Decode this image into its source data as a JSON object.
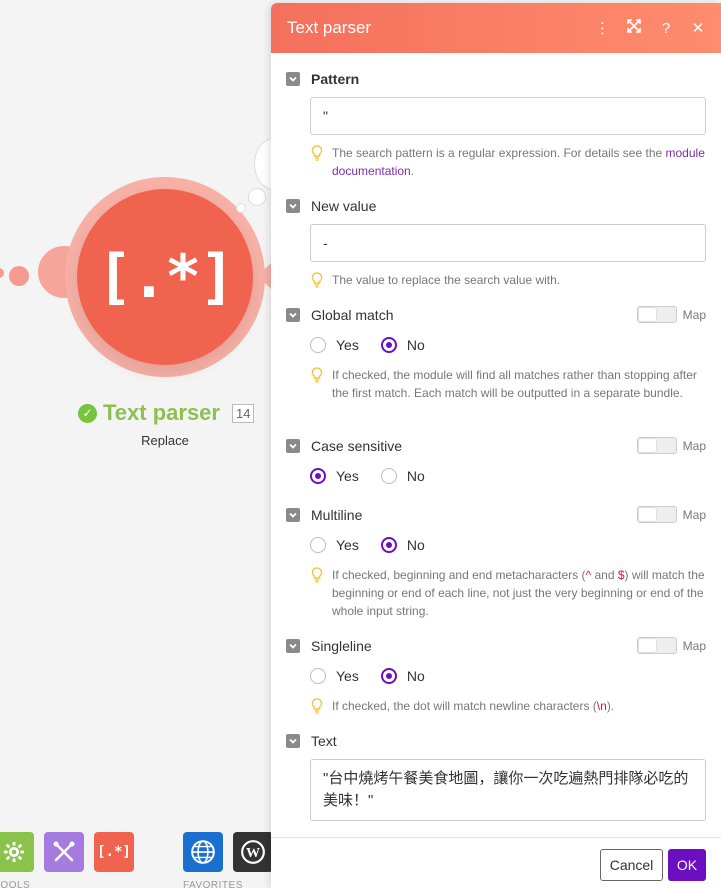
{
  "canvas": {
    "module": {
      "glyph": "[.*]",
      "title": "Text parser",
      "op_count": "14",
      "subtitle": "Replace"
    },
    "toolbar": {
      "label_tools": "TOOLS",
      "label_favorites": "FAVORITES",
      "text_parser_glyph": "[.*]"
    }
  },
  "panel": {
    "title": "Text parser",
    "header_icons": [
      "more-icon",
      "expand-icon",
      "help-icon",
      "close-icon"
    ],
    "fields": {
      "pattern": {
        "label": "Pattern",
        "value": "\"",
        "hint_text": "The search pattern is a regular expression. For details see the ",
        "hint_link": "module documentation",
        "hint_end": "."
      },
      "new_value": {
        "label": "New value",
        "value": "-",
        "hint": "The value to replace the search value with."
      },
      "global_match": {
        "label": "Global match",
        "map_label": "Map",
        "yes": "Yes",
        "no": "No",
        "selected": "No",
        "hint": "If checked, the module will find all matches rather than stopping after the first match. Each match will be outputted in a separate bundle."
      },
      "case_sensitive": {
        "label": "Case sensitive",
        "map_label": "Map",
        "yes": "Yes",
        "no": "No",
        "selected": "Yes"
      },
      "multiline": {
        "label": "Multiline",
        "map_label": "Map",
        "yes": "Yes",
        "no": "No",
        "selected": "No",
        "hint_a": "If checked, beginning and end metacharacters (",
        "hint_caret": "^",
        "hint_b": " and ",
        "hint_dollar": "$",
        "hint_c": ") will match the beginning or end of each line, not just the very beginning or end of the whole input string."
      },
      "singleline": {
        "label": "Singleline",
        "map_label": "Map",
        "yes": "Yes",
        "no": "No",
        "selected": "No",
        "hint_a": "If checked, the dot will match newline characters (",
        "hint_code": "\\n",
        "hint_b": ")."
      },
      "text": {
        "label": "Text",
        "value": "\"台中燒烤午餐美食地圖，讓你一次吃遍熱門排隊必吃的美味！\""
      }
    },
    "footer": {
      "cancel_label": "Cancel",
      "ok_label": "OK"
    }
  },
  "colors": {
    "header_start": "#f4705c",
    "header_end": "#ff8c6e",
    "accent_purple": "#6b0fc1",
    "node_red": "#f0634f",
    "success_green": "#8cc152"
  }
}
